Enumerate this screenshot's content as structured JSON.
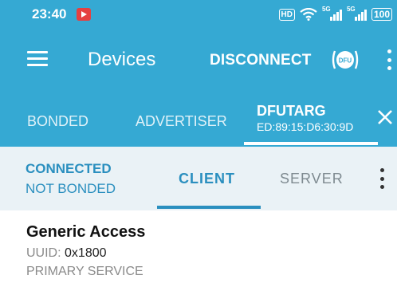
{
  "status_bar": {
    "time": "23:40",
    "hd": "HD",
    "sig1_gen": "5G",
    "sig2_gen": "5G",
    "battery": "100"
  },
  "app_bar": {
    "title": "Devices",
    "disconnect_label": "DISCONNECT",
    "dfu_label": "DFU"
  },
  "device_tabs": {
    "items": [
      {
        "label": "BONDED"
      },
      {
        "label": "ADVERTISER"
      },
      {
        "name": "DFUTARG",
        "address": "ED:89:15:D6:30:9D"
      }
    ]
  },
  "connection": {
    "status": "CONNECTED",
    "bond": "NOT BONDED"
  },
  "sub_tabs": {
    "client": "CLIENT",
    "server": "SERVER"
  },
  "service": {
    "name": "Generic Access",
    "uuid_label": "UUID:",
    "uuid_value": "0x1800",
    "type": "PRIMARY SERVICE"
  },
  "colors": {
    "primary": "#35a9d3",
    "accent": "#2a8fbf",
    "subtab_bg": "#eaf2f6"
  }
}
